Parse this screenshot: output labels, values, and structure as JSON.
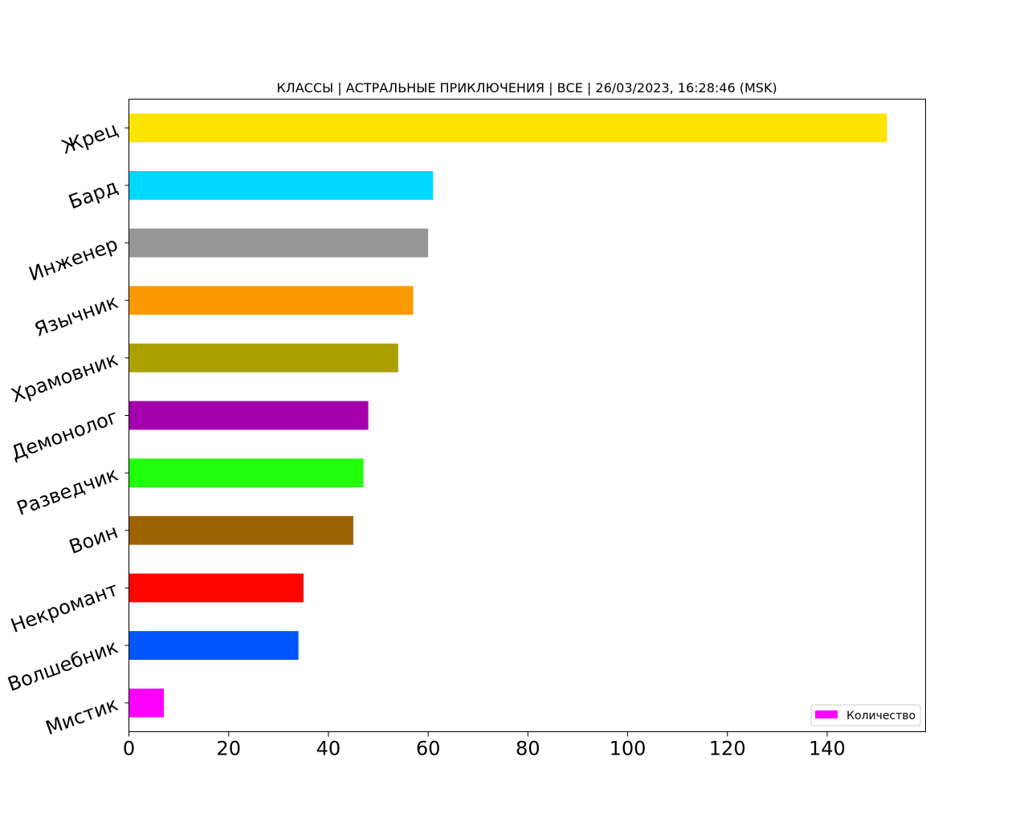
{
  "chart_data": {
    "type": "bar",
    "orientation": "horizontal",
    "title": "КЛАССЫ | АСТРАЛЬНЫЕ ПРИКЛЮЧЕНИЯ | ВСЕ | 26/03/2023, 16:28:46 (MSK)",
    "xlabel": "",
    "ylabel": "",
    "xlim": [
      0,
      160
    ],
    "xticks": [
      0,
      20,
      40,
      60,
      80,
      100,
      120,
      140
    ],
    "grid": false,
    "legend": {
      "position": "bottom-right",
      "entries": [
        {
          "name": "Количество",
          "color": "#ff00ff"
        }
      ]
    },
    "categories": [
      "Жрец",
      "Бард",
      "Инженер",
      "Язычник",
      "Храмовник",
      "Демонолог",
      "Разведчик",
      "Воин",
      "Некромант",
      "Волшебник",
      "Мистик"
    ],
    "values": [
      152,
      61,
      60,
      57,
      54,
      48,
      47,
      45,
      35,
      34,
      7
    ],
    "colors": [
      "#fde400",
      "#00d8ff",
      "#969696",
      "#fa9a00",
      "#aba000",
      "#a400ae",
      "#21ff0d",
      "#9c6400",
      "#ff0500",
      "#0055ff",
      "#ff00ff"
    ]
  }
}
